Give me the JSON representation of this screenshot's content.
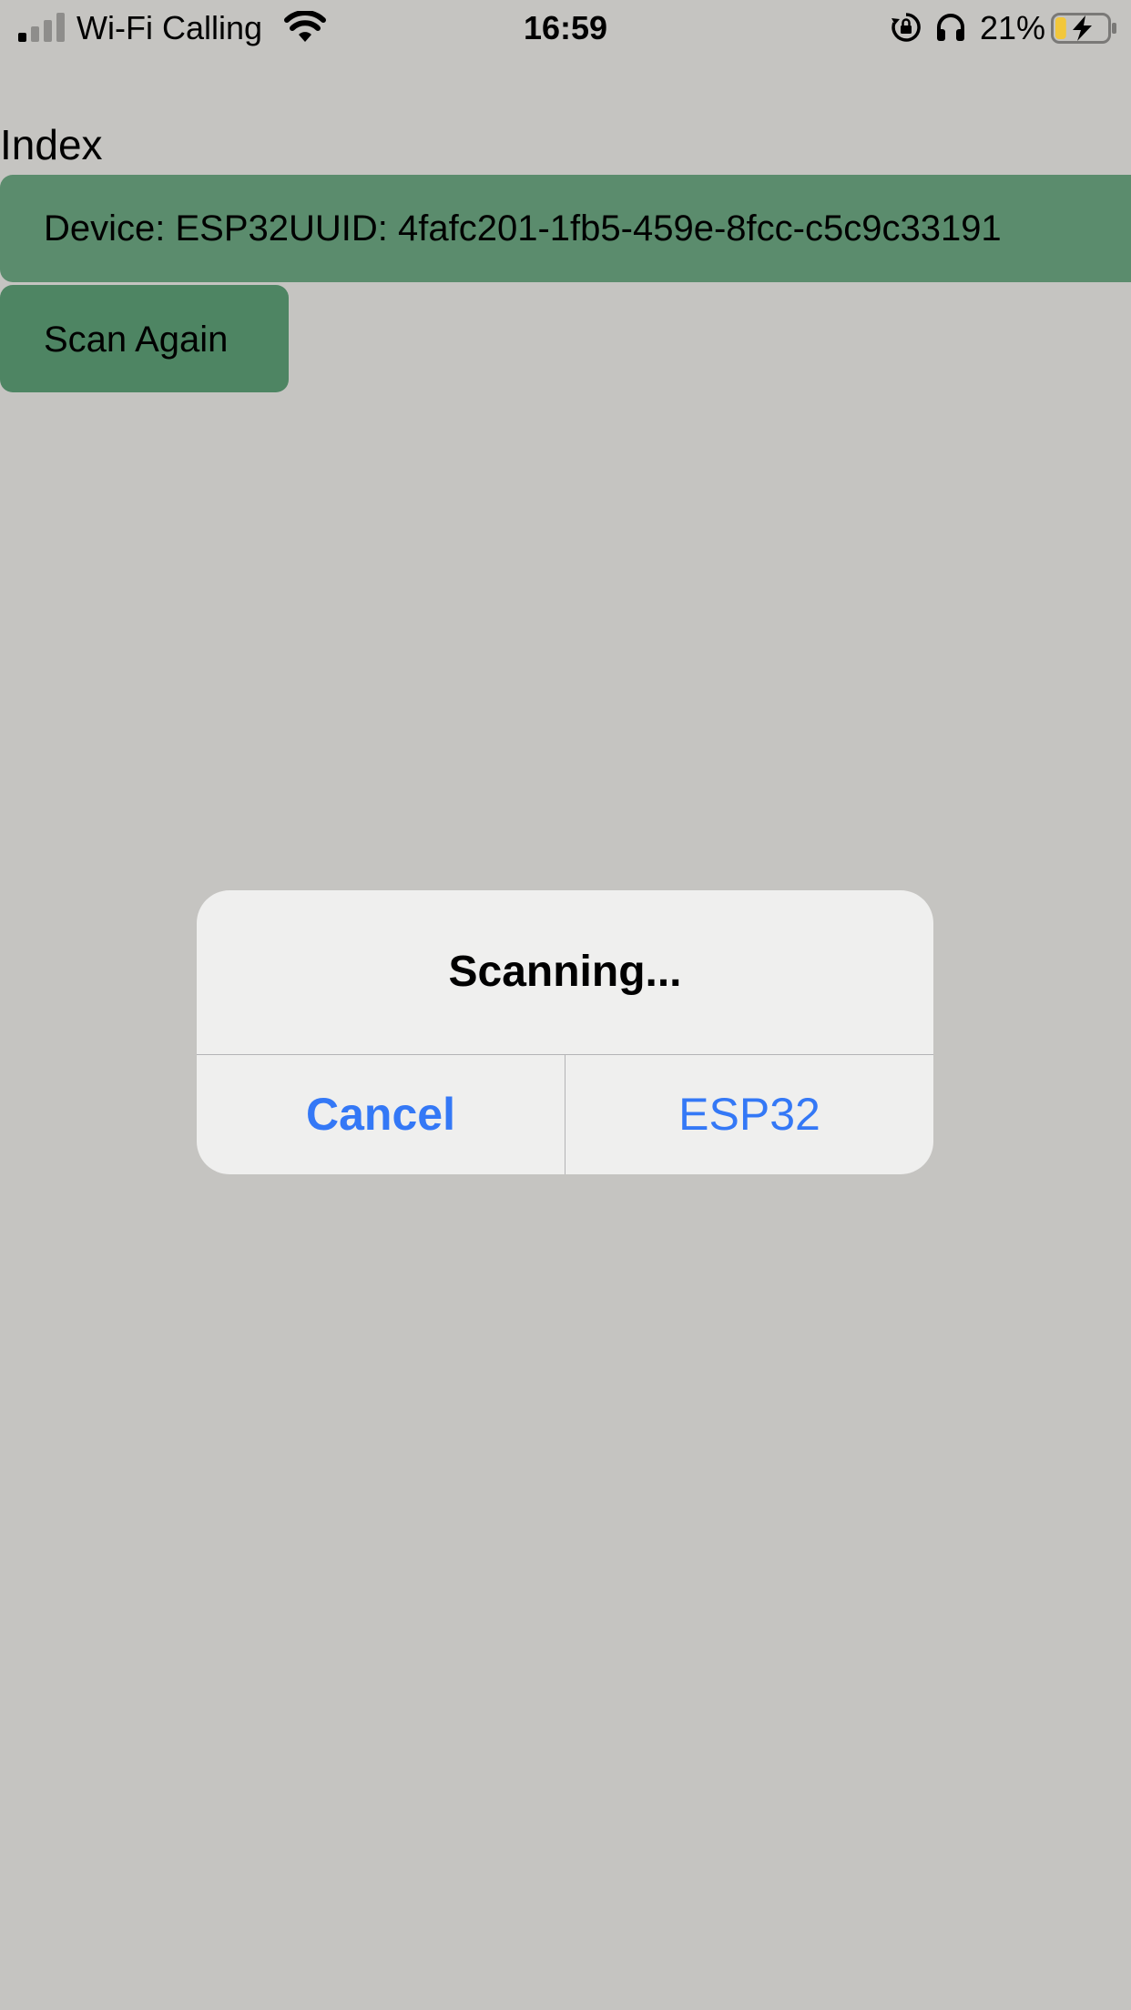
{
  "status_bar": {
    "carrier": "Wi-Fi Calling",
    "time": "16:59",
    "battery_percent": "21%",
    "battery_level": 0.21,
    "icons": [
      "signal-icon",
      "wifi-icon",
      "rotation-lock-icon",
      "headphones-icon",
      "battery-charging-icon"
    ]
  },
  "page": {
    "title": "Index",
    "device_row_label": "Device: ESP32UUID: 4fafc201-1fb5-459e-8fcc-c5c9c33191",
    "scan_again_label": "Scan Again"
  },
  "alert": {
    "title": "Scanning...",
    "cancel_label": "Cancel",
    "option_label": "ESP32"
  },
  "colors": {
    "background": "#c5c4c1",
    "device_row": "#5b8c6d",
    "scan_button": "#4e8563",
    "alert_bg": "#efefee",
    "accent": "#3478f6",
    "battery_fill": "#f2c73b"
  }
}
